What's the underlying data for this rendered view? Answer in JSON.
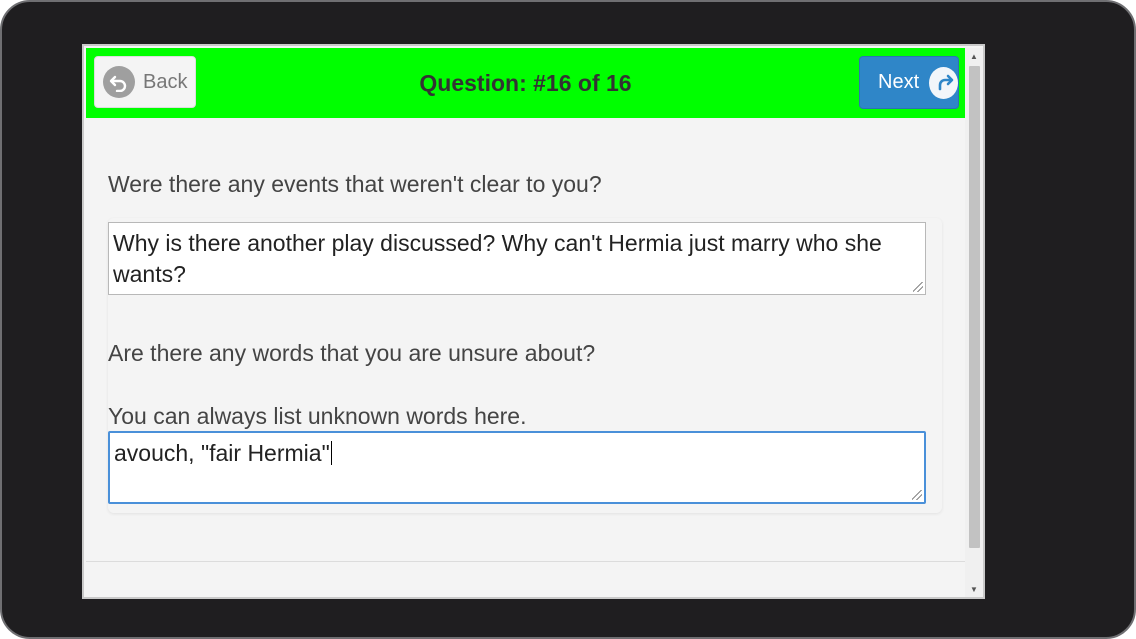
{
  "header": {
    "back_label": "Back",
    "title": "Question: #16 of 16",
    "next_label": "Next",
    "background_color": "#00ff00",
    "next_color": "#2f86c8"
  },
  "questions": [
    {
      "prompt": "Were there any events that weren't clear to you?",
      "answer": "Why is there another play discussed? Why can't Hermia just marry who she wants?"
    },
    {
      "prompt": "Are there any words that you are unsure about?",
      "hint": "You can always list unknown words here.",
      "answer": "avouch, \"fair Hermia\""
    }
  ],
  "icons": {
    "back": "undo-arrow-icon",
    "next": "redo-arrow-icon"
  }
}
